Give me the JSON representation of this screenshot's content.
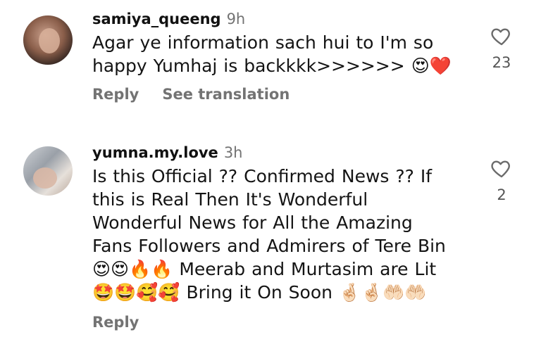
{
  "comments": [
    {
      "username": "samiya_queeng",
      "time": "9h",
      "lines": [
        "Agar ye information sach hui to I'm so",
        "happy Yumhaj is backkkk>>>>>> 😍❤️"
      ],
      "actions": [
        "Reply",
        "See translation"
      ],
      "like_count": "23",
      "avatar_icon": "profile-photo",
      "like_icon": "heart-outline-icon"
    },
    {
      "username": "yumna.my.love",
      "time": "3h",
      "lines": [
        "Is this Official ?? Confirmed News ?? If",
        "this is Real Then It's Wonderful",
        "Wonderful News for All the Amazing",
        "Fans Followers and Admirers of Tere Bin",
        "😍😍🔥🔥 Meerab and Murtasim are Lit",
        "🤩🤩🥰🥰 Bring it On Soon 🤞🏻🤞🏻🤲🏻🤲🏻"
      ],
      "actions": [
        "Reply"
      ],
      "like_count": "2",
      "avatar_icon": "profile-photo",
      "like_icon": "heart-outline-icon"
    }
  ]
}
